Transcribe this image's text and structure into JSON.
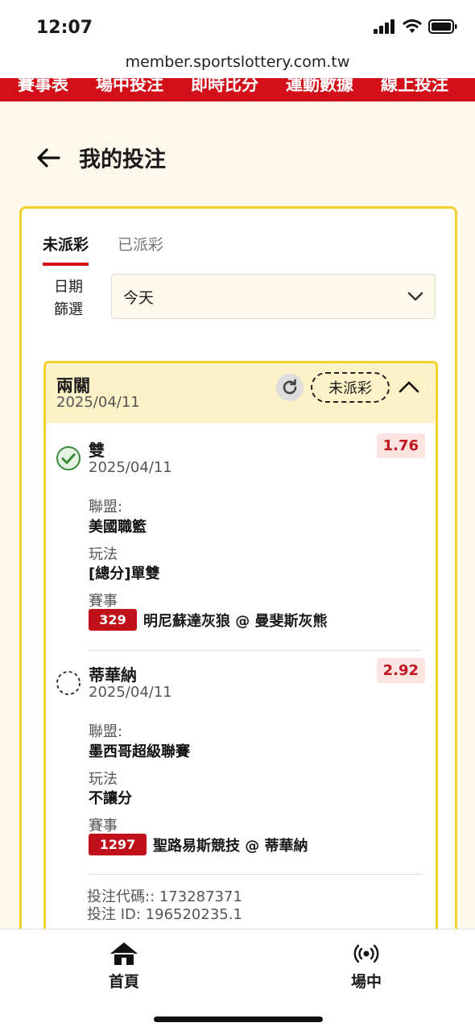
{
  "status_bar": {
    "time": "12:07"
  },
  "browser": {
    "url": "member.sportslottery.com.tw"
  },
  "top_nav": {
    "items": [
      "賽事表",
      "場中投注",
      "即時比分",
      "運動數據",
      "線上投注"
    ]
  },
  "header": {
    "title": "我的投注"
  },
  "tabs": [
    {
      "label": "未派彩",
      "active": true
    },
    {
      "label": "已派彩",
      "active": false
    }
  ],
  "date_filter": {
    "label_line1": "日期",
    "label_line2": "篩選",
    "value": "今天"
  },
  "bet": {
    "type": "兩關",
    "date": "2025/04/11",
    "status": "未派彩",
    "selections": [
      {
        "name": "雙",
        "date": "2025/04/11",
        "odds": "1.76",
        "status": "won",
        "league_label": "聯盟:",
        "league": "美國職籃",
        "market_label": "玩法",
        "market": "[總分]單雙",
        "event_label": "賽事",
        "event_no": "329",
        "event": "明尼蘇達灰狼 @ 曼斐斯灰熊"
      },
      {
        "name": "蒂華納",
        "date": "2025/04/11",
        "odds": "2.92",
        "status": "pending",
        "league_label": "聯盟:",
        "league": "墨西哥超級聯賽",
        "market_label": "玩法",
        "market": "不讓分",
        "event_label": "賽事",
        "event_no": "1297",
        "event": "聖路易斯競技 @ 蒂華納"
      }
    ],
    "bet_code": "投注代碼:: 173287371",
    "bet_id": "投注 ID: 196520235.1"
  },
  "bottom_nav": {
    "home": "首頁",
    "live": "場中"
  },
  "colors": {
    "brand_red": "#d3101a",
    "highlight_yellow": "#f2d12c",
    "odds_red": "#c0161f",
    "won_green": "#3a8a3a"
  }
}
